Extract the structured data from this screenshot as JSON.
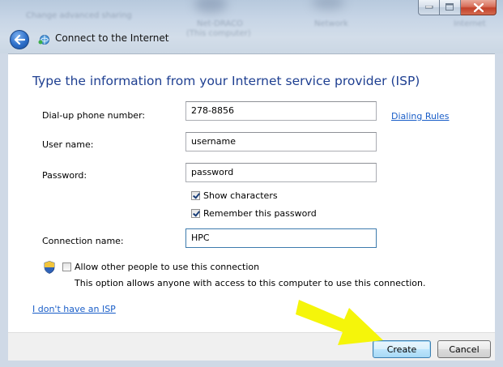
{
  "window": {
    "title": "Connect to the Internet"
  },
  "background_blur": {
    "text1": "Change advanced sharing",
    "text2": "Net-DRACO",
    "text3": "(This computer)",
    "text4": "Network",
    "text5": "Internet"
  },
  "form": {
    "heading": "Type the information from your Internet service provider (ISP)",
    "phone_label": "Dial-up phone number:",
    "phone_value": "278-8856",
    "dialing_rules_link": "Dialing Rules",
    "username_label": "User name:",
    "username_value": "username",
    "password_label": "Password:",
    "password_value": "password",
    "show_characters_label": "Show characters",
    "show_characters_checked": true,
    "remember_password_label": "Remember this password",
    "remember_password_checked": true,
    "connection_name_label": "Connection name:",
    "connection_name_value": "HPC",
    "allow_others_label": "Allow other people to use this connection",
    "allow_others_checked": false,
    "allow_others_help": "This option allows anyone with access to this computer to use this connection.",
    "no_isp_link": "I don't have an ISP"
  },
  "footer": {
    "create_label": "Create",
    "cancel_label": "Cancel"
  },
  "colors": {
    "heading": "#1e3f91",
    "link": "#1a5ec8",
    "arrow": "#f5f50a"
  },
  "icons": {
    "back": "back-arrow-icon",
    "network": "network-connection-icon",
    "shield": "uac-shield-icon",
    "minimize": "minimize-icon",
    "maximize": "maximize-icon",
    "close": "close-icon",
    "pointer": "yellow-arrow-annotation"
  }
}
